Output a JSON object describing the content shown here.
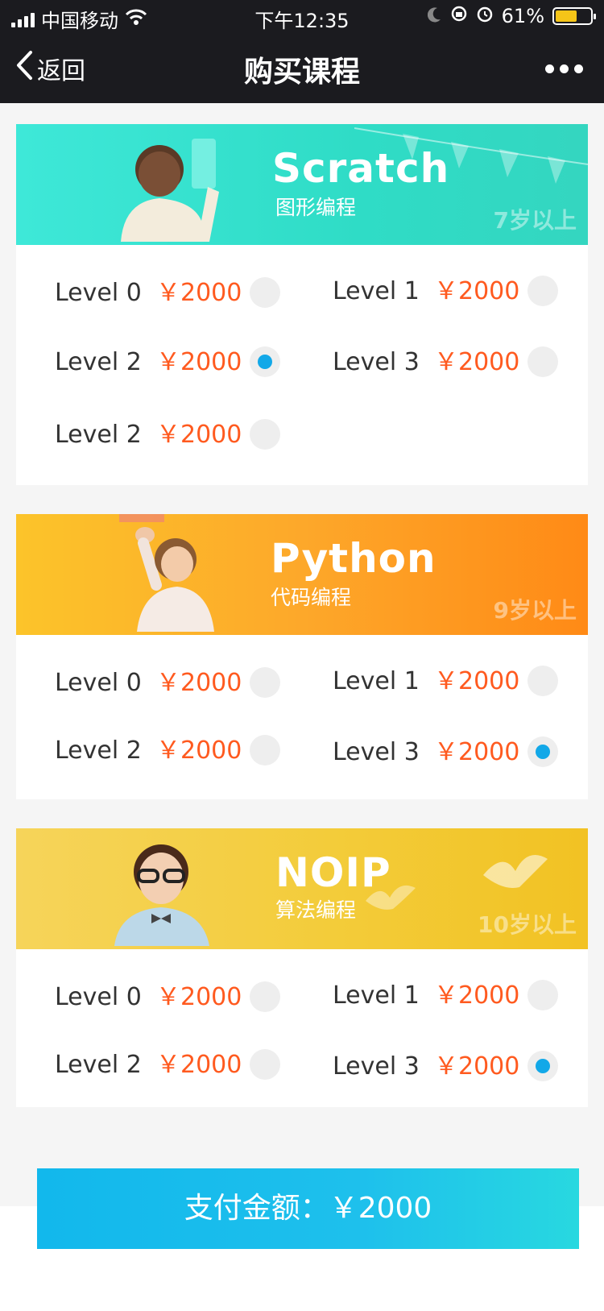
{
  "status_bar": {
    "carrier": "中国移动",
    "time": "下午12:35",
    "battery": "61%"
  },
  "nav": {
    "back_label": "返回",
    "title": "购买课程"
  },
  "courses": [
    {
      "title": "Scratch",
      "subtitle": "图形编程",
      "age": "7岁以上",
      "options": [
        {
          "level": "Level 0",
          "price": "￥2000",
          "selected": false
        },
        {
          "level": "Level 1",
          "price": "￥2000",
          "selected": false
        },
        {
          "level": "Level 2",
          "price": "￥2000",
          "selected": true
        },
        {
          "level": "Level 3",
          "price": "￥2000",
          "selected": false
        },
        {
          "level": "Level 2",
          "price": "￥2000",
          "selected": false
        }
      ]
    },
    {
      "title": "Python",
      "subtitle": "代码编程",
      "age": "9岁以上",
      "options": [
        {
          "level": "Level 0",
          "price": "￥2000",
          "selected": false
        },
        {
          "level": "Level 1",
          "price": "￥2000",
          "selected": false
        },
        {
          "level": "Level 2",
          "price": "￥2000",
          "selected": false
        },
        {
          "level": "Level 3",
          "price": "￥2000",
          "selected": true
        }
      ]
    },
    {
      "title": "NOIP",
      "subtitle": "算法编程",
      "age": "10岁以上",
      "options": [
        {
          "level": "Level 0",
          "price": "￥2000",
          "selected": false
        },
        {
          "level": "Level 1",
          "price": "￥2000",
          "selected": false
        },
        {
          "level": "Level 2",
          "price": "￥2000",
          "selected": false
        },
        {
          "level": "Level 3",
          "price": "￥2000",
          "selected": true
        }
      ]
    }
  ],
  "pay": {
    "label": "支付金额：￥2000"
  },
  "colors": {
    "accent": "#12a8e8",
    "price": "#ff5a1f",
    "bar": "#1b1b1f"
  }
}
